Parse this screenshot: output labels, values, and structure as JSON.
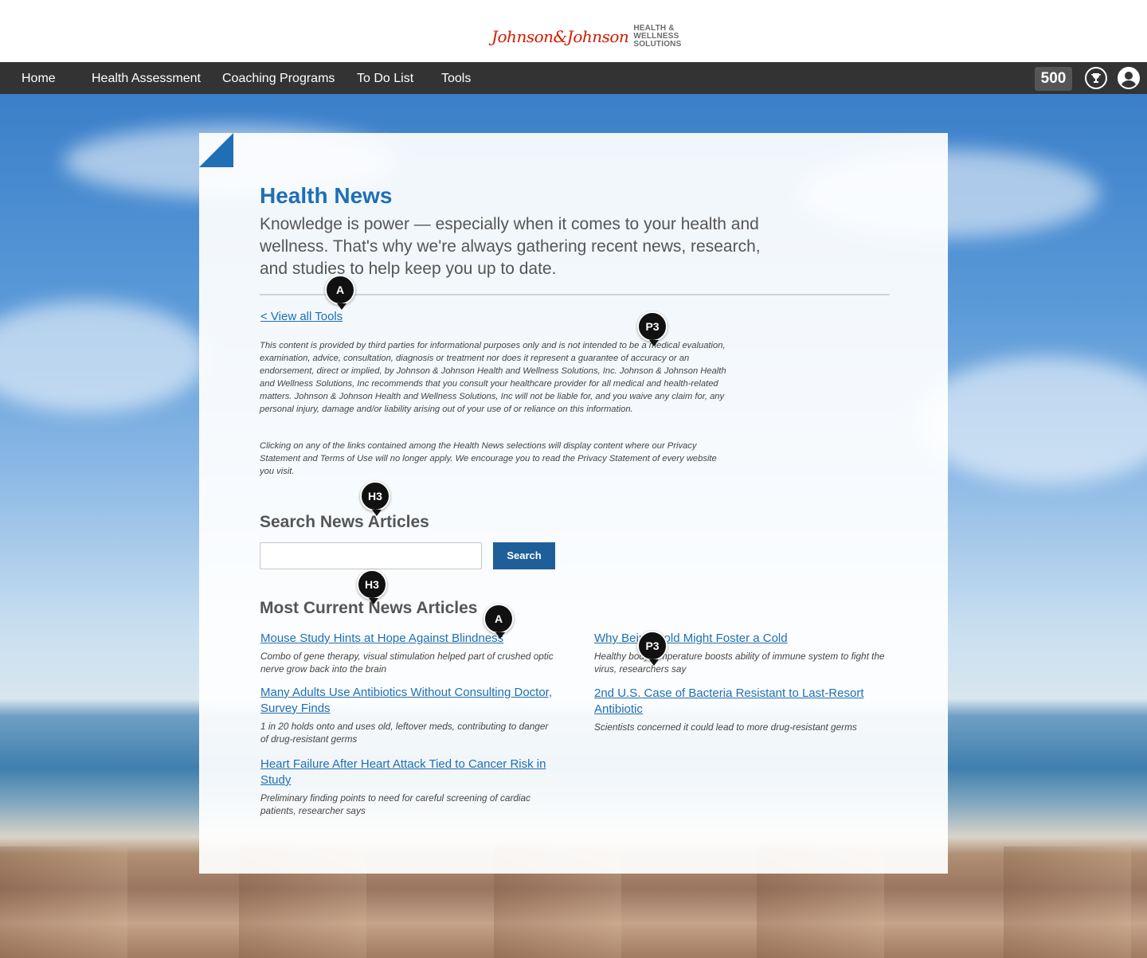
{
  "header": {
    "logo_script": "Johnson&Johnson",
    "logo_line1": "HEALTH &",
    "logo_line2": "WELLNESS",
    "logo_line3": "SOLUTIONS"
  },
  "nav": {
    "items": [
      "Home",
      "Health Assessment",
      "Coaching Programs",
      "To Do List",
      "Tools"
    ],
    "points": "500",
    "trophy_icon": "trophy-icon",
    "profile_icon": "user-profile-icon"
  },
  "main": {
    "title": "Health News",
    "intro": "Knowledge is power — especially when it comes to your health and wellness. That's why we're always gathering recent news, research, and studies to help keep you up to date.",
    "back_link": "< View all Tools",
    "disclaimer_1": "This content is provided by third parties for informational purposes only and is not intended to be a medical evaluation, examination, advice, consultation, diagnosis or treatment nor does it represent a guarantee of accuracy or an endorsement, direct or implied, by Johnson & Johnson Health and Wellness Solutions, Inc. Johnson & Johnson Health and Wellness Solutions, Inc recommends that you consult your healthcare provider for all medical and health-related matters. Johnson & Johnson Health and Wellness Solutions, Inc will not be liable for, and you waive any claim for, any personal injury, damage and/or liability arising out of your use of or reliance on this information.",
    "disclaimer_2": "Clicking on any of the links contained among the Health News selections will display content where our Privacy Statement and Terms of Use will no longer apply. We encourage you to read the Privacy Statement of every website you visit.",
    "search_heading": "Search News Articles",
    "search_value": "",
    "search_button": "Search",
    "articles_heading": "Most Current News Articles",
    "articles": [
      {
        "title": "Mouse Study Hints at Hope Against Blindness",
        "summary": "Combo of gene therapy, visual stimulation helped part of crushed optic nerve grow back into the brain"
      },
      {
        "title": "Why Being Cold Might Foster a Cold",
        "summary": "Healthy body temperature boosts ability of immune system to fight the virus, researchers say"
      },
      {
        "title": "Many Adults Use Antibiotics Without Consulting Doctor, Survey Finds",
        "summary": "1 in 20 holds onto and uses old, leftover meds, contributing to danger of drug-resistant germs"
      },
      {
        "title": "2nd U.S. Case of Bacteria Resistant to Last-Resort Antibiotic",
        "summary": "Scientists concerned it could lead to more drug-resistant germs"
      },
      {
        "title": "Heart Failure After Heart Attack Tied to Cancer Risk in Study",
        "summary": "Preliminary finding points to need for careful screening of cardiac patients, researcher says"
      }
    ]
  },
  "markers": [
    "A",
    "P3",
    "H3",
    "H3",
    "A",
    "P3"
  ],
  "colors": {
    "brand_blue": "#1e6fb4",
    "nav_bg": "#333333",
    "search_button": "#1e5f99",
    "logo_red": "#d51900"
  }
}
